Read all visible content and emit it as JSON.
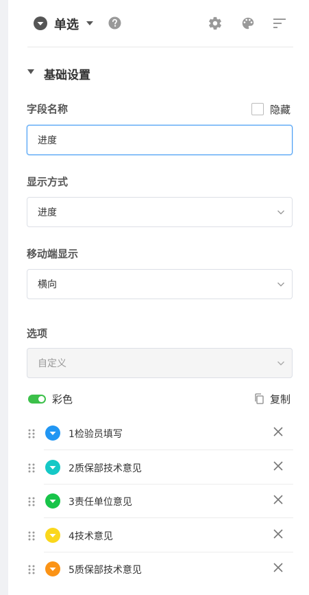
{
  "header": {
    "field_type": "单选",
    "icons": [
      "field-type-icon",
      "dropdown-caret-icon",
      "help-icon",
      "settings-gear-icon",
      "palette-icon",
      "sort-lines-icon"
    ]
  },
  "section": {
    "title": "基础设置"
  },
  "field_name": {
    "label": "字段名称",
    "value": "进度",
    "hidden_label": "隐藏",
    "hidden_checked": false
  },
  "display_mode": {
    "label": "显示方式",
    "value": "进度"
  },
  "mobile_display": {
    "label": "移动端显示",
    "value": "横向"
  },
  "options": {
    "label": "选项",
    "source": "自定义",
    "color_label": "彩色",
    "color_on": true,
    "copy_label": "复制",
    "items": [
      {
        "label": "1检验员填写",
        "color": "#2196f3"
      },
      {
        "label": "2质保部技术意见",
        "color": "#15c8c6"
      },
      {
        "label": "3责任单位意见",
        "color": "#18c449"
      },
      {
        "label": "4技术意见",
        "color": "#fad71c"
      },
      {
        "label": "5质保部技术意见",
        "color": "#fb9316"
      }
    ]
  },
  "colors": {
    "accent": "#4a9ff5",
    "toggle": "#3cc04a"
  }
}
